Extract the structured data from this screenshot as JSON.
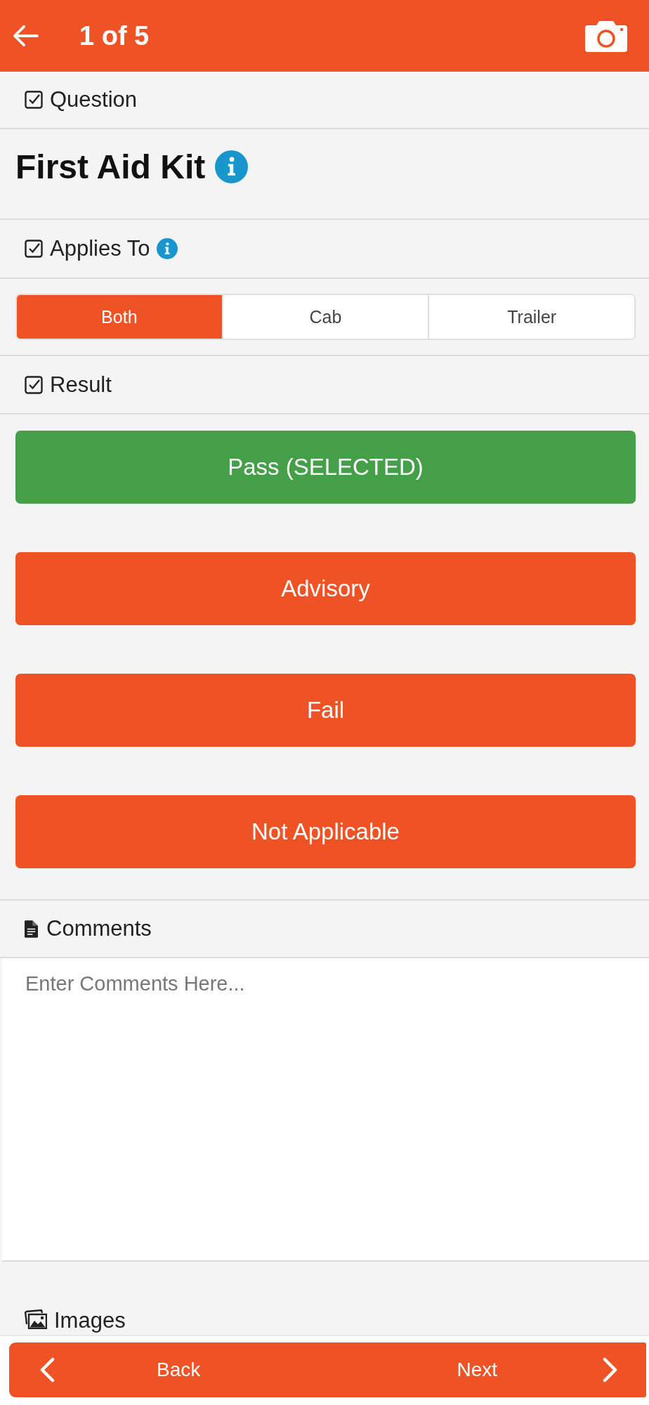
{
  "top_bar": {
    "title": "1 of 5"
  },
  "question": {
    "heading": "Question",
    "title": "First Aid Kit"
  },
  "applies_to": {
    "heading": "Applies To",
    "options": [
      {
        "label": "Both",
        "selected": true
      },
      {
        "label": "Cab",
        "selected": false
      },
      {
        "label": "Trailer",
        "selected": false
      }
    ]
  },
  "result": {
    "heading": "Result",
    "options": [
      {
        "label": "Pass (SELECTED)",
        "selected": true
      },
      {
        "label": "Advisory",
        "selected": false
      },
      {
        "label": "Fail",
        "selected": false
      },
      {
        "label": "Not Applicable",
        "selected": false
      }
    ]
  },
  "comments": {
    "heading": "Comments",
    "placeholder": "Enter Comments Here..."
  },
  "images": {
    "heading": "Images"
  },
  "nav": {
    "back": "Back",
    "next": "Next"
  }
}
